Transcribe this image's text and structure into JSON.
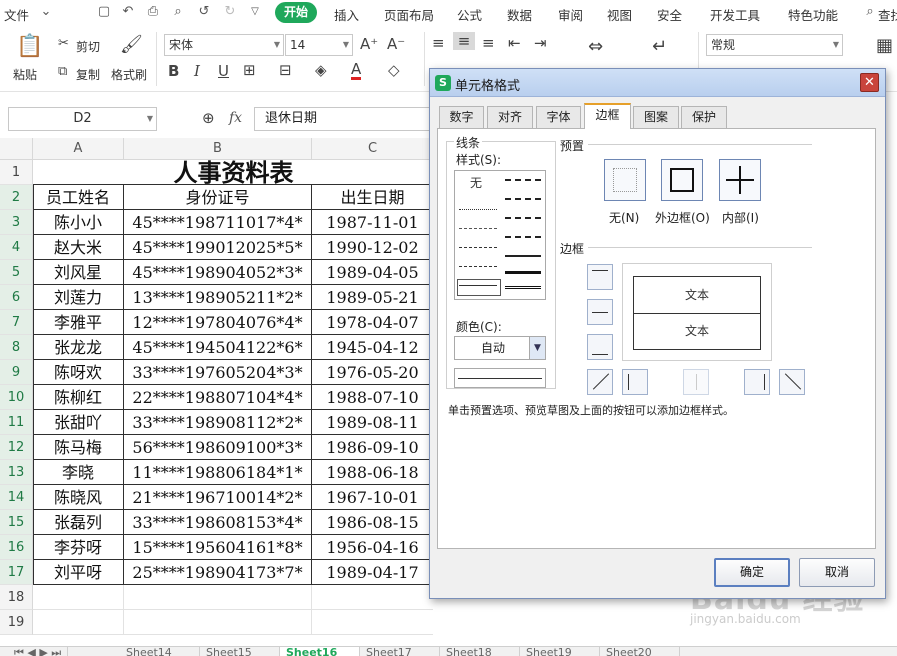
{
  "ribbon": {
    "file_menu": "文件",
    "tabs": [
      "开始",
      "插入",
      "页面布局",
      "公式",
      "数据",
      "审阅",
      "视图",
      "安全",
      "开发工具",
      "特色功能",
      "查找"
    ],
    "paste_label": "粘贴",
    "cut_label": "剪切",
    "copy_label": "复制",
    "format_painter_label": "格式刷",
    "font_name": "宋体",
    "font_size": "14",
    "number_format": "常规"
  },
  "formula_bar": {
    "name_box": "D2",
    "fx_label": "fx",
    "content": "退休日期"
  },
  "sheet": {
    "columns": [
      "A",
      "B",
      "C"
    ],
    "row_numbers": [
      "1",
      "2",
      "3",
      "4",
      "5",
      "6",
      "7",
      "8",
      "9",
      "10",
      "11",
      "12",
      "13",
      "14",
      "15",
      "16",
      "17",
      "18",
      "19"
    ],
    "title": "人事资料表",
    "headers": [
      "员工姓名",
      "身份证号",
      "出生日期"
    ],
    "rows": [
      [
        "陈小小",
        "45****198711017*4*",
        "1987-11-01"
      ],
      [
        "赵大米",
        "45****199012025*5*",
        "1990-12-02"
      ],
      [
        "刘风星",
        "45****198904052*3*",
        "1989-04-05"
      ],
      [
        "刘莲力",
        "13****198905211*2*",
        "1989-05-21"
      ],
      [
        "李雅平",
        "12****197804076*4*",
        "1978-04-07"
      ],
      [
        "张龙龙",
        "45****194504122*6*",
        "1945-04-12"
      ],
      [
        "陈呀欢",
        "33****197605204*3*",
        "1976-05-20"
      ],
      [
        "陈柳红",
        "22****198807104*4*",
        "1988-07-10"
      ],
      [
        "张甜吖",
        "33****198908112*2*",
        "1989-08-11"
      ],
      [
        "陈马梅",
        "56****198609100*3*",
        "1986-09-10"
      ],
      [
        "李晓",
        "11****198806184*1*",
        "1988-06-18"
      ],
      [
        "陈晓风",
        "21****196710014*2*",
        "1967-10-01"
      ],
      [
        "张磊列",
        "33****198608153*4*",
        "1986-08-15"
      ],
      [
        "李芬呀",
        "15****195604161*8*",
        "1956-04-16"
      ],
      [
        "刘平呀",
        "25****198904173*7*",
        "1989-04-17"
      ]
    ]
  },
  "sheet_tabs": [
    "Sheet14",
    "Sheet15",
    "Sheet16",
    "Sheet17",
    "Sheet18",
    "Sheet19",
    "Sheet20"
  ],
  "dialog": {
    "title": "单元格格式",
    "tabs": [
      "数字",
      "对齐",
      "字体",
      "边框",
      "图案",
      "保护"
    ],
    "active_tab": "边框",
    "line_group": "线条",
    "style_label": "样式(S):",
    "none_style": "无",
    "color_label": "颜色(C):",
    "color_value": "自动",
    "preset_group": "预置",
    "presets": [
      "无(N)",
      "外边框(O)",
      "内部(I)"
    ],
    "border_group": "边框",
    "preview_text": [
      "文本",
      "文本"
    ],
    "hint": "单击预置选项、预览草图及上面的按钮可以添加边框样式。",
    "ok": "确定",
    "cancel": "取消"
  },
  "watermark": {
    "brand": "Baidu 经验",
    "url": "jingyan.baidu.com"
  }
}
